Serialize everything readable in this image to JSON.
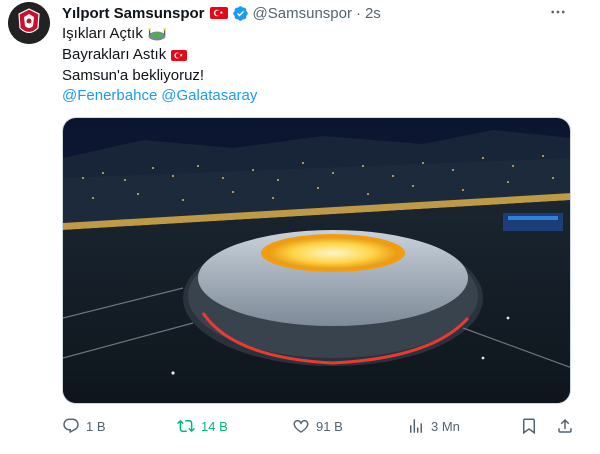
{
  "author": {
    "name": "Yılport Samsunspor",
    "handle": "@Samsunspor",
    "separator": "·",
    "time": "2s"
  },
  "tweet": {
    "line1": "Işıkları Açtık",
    "line2": "Bayrakları Astık",
    "line3": "Samsun'a bekliyoruz!",
    "mention1": "@Fenerbahce",
    "mention2": "@Galatasaray"
  },
  "actions": {
    "replies": "1 B",
    "retweets": "14 B",
    "likes": "91 B",
    "views": "3 Mn"
  },
  "colors": {
    "link": "#1d9bf0",
    "retweet_active": "#00ba7c",
    "muted": "#536471",
    "flag_red": "#e30a17"
  },
  "icons": [
    "more-icon",
    "verified-icon",
    "reply-icon",
    "retweet-icon",
    "like-icon",
    "views-icon",
    "bookmark-icon",
    "share-icon"
  ]
}
